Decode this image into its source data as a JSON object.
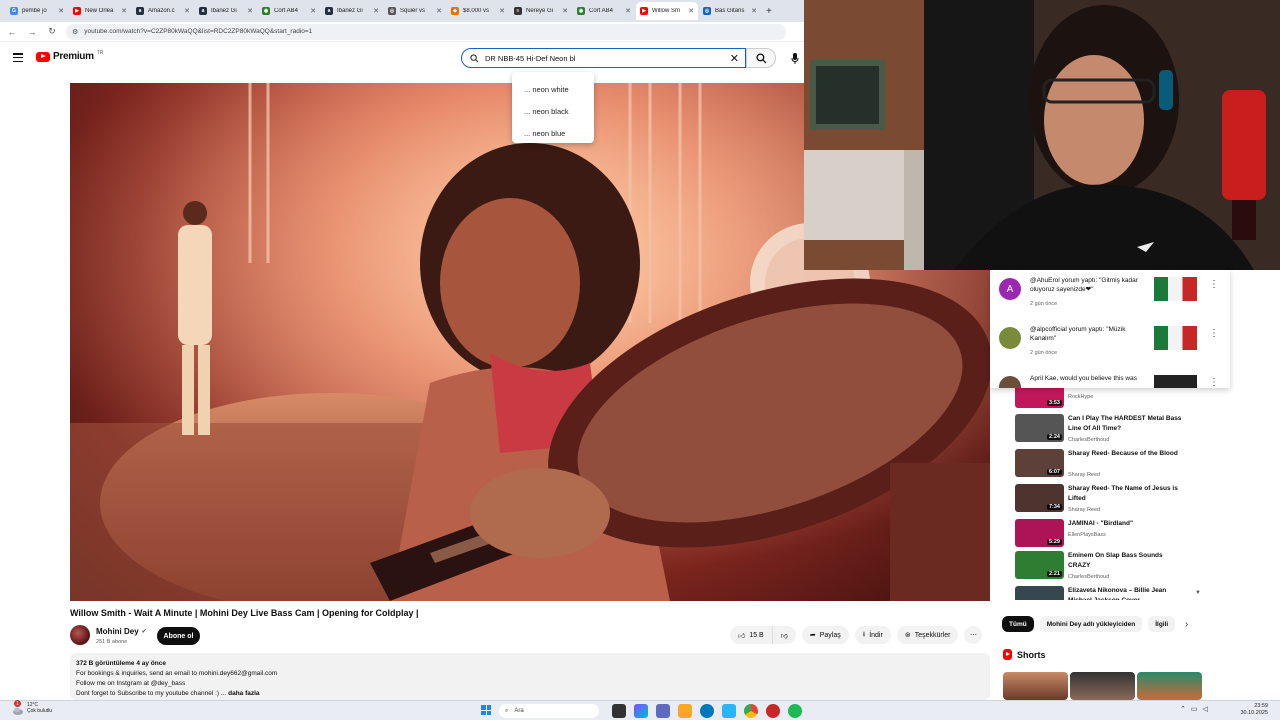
{
  "browser": {
    "tabs": [
      {
        "label": "pembe jo",
        "color": "#4285f4",
        "glyph": "G"
      },
      {
        "label": "New Orlea",
        "color": "#ff0000",
        "glyph": "▶"
      },
      {
        "label": "Amazon.c",
        "color": "#232f3e",
        "glyph": "a"
      },
      {
        "label": "Ibanez Gi",
        "color": "#232f3e",
        "glyph": "a"
      },
      {
        "label": "Cort AB4",
        "color": "#2e7d32",
        "glyph": "◉"
      },
      {
        "label": "Ibanez Gi",
        "color": "#232f3e",
        "glyph": "a"
      },
      {
        "label": "Squier vs",
        "color": "#555555",
        "glyph": "◎"
      },
      {
        "label": "$8.000 vs",
        "color": "#ef6c00",
        "glyph": "◆"
      },
      {
        "label": "Nereye Gi",
        "color": "#333333",
        "glyph": "≡"
      },
      {
        "label": "Cort AB4",
        "color": "#2e7d32",
        "glyph": "◉"
      },
      {
        "label": "Willow Sm",
        "color": "#ff0000",
        "glyph": "▶"
      },
      {
        "label": "Bas Gitaris",
        "color": "#1565c0",
        "glyph": "◎"
      }
    ],
    "active_tab": 10,
    "new_tab": "+",
    "url": "youtube.com/watch?v=C2ZP80kWaQQ&list=RDC2ZP80kWaQQ&start_radio=1"
  },
  "youtube": {
    "logo": "Premium",
    "logo_sup": "TR",
    "search_query": "DR NBB-45 Hi-Def Neon bl",
    "suggestions": [
      "... neon white",
      "... neon black",
      "... neon blue"
    ]
  },
  "video": {
    "title": "Willow Smith - Wait A Minute | Mohini Dey Live Bass Cam | Opening for Coldplay |",
    "channel": "Mohini Dey",
    "subscribers": "251 B abone",
    "subscribe_label": "Abone ol",
    "likes": "15 B",
    "share_label": "Paylaş",
    "download_label": "İndir",
    "thanks_label": "Teşekkürler",
    "views_meta": "372 B görüntüleme  4 ay önce",
    "desc_line1": "For bookings & inquiries, send an email to mohini.dey662@gmail.com",
    "desc_line2": "Follow me on Instgram at @dey_bass",
    "desc_line3": "Dont forget to Subscribe to my youtube channel :) ...",
    "more_label": "daha fazla"
  },
  "notifications": [
    {
      "avatar_letter": "A",
      "avatar_color": "#9c27b0",
      "text": "@AhuErol yorum yaptı: \"Gitmiş kadar oluyoruz sayenizde❤\"",
      "time": "2 gün önce"
    },
    {
      "avatar_letter": "",
      "avatar_color": "#7a8a3a",
      "text": "@alpcofficial yorum yaptı: \"Müzik Kanalım\"",
      "time": "2 gün önce"
    },
    {
      "avatar_letter": "",
      "avatar_color": "#6b4f3a",
      "text": "April Kae, would you believe this was",
      "time": ""
    }
  ],
  "recommended": [
    {
      "title": "",
      "channel": "RockHype",
      "duration": "3:53",
      "color": "#c2185b"
    },
    {
      "title": "Can I Play The HARDEST Metal Bass Line Of All Time?",
      "channel": "CharlesBerthoud",
      "duration": "2:24",
      "color": "#555555"
    },
    {
      "title": "Sharay Reed- Because of the Blood",
      "channel": "Sharay Reed",
      "duration": "6:07",
      "color": "#5d4037"
    },
    {
      "title": "Sharay Reed- The Name of Jesus is Lifted",
      "channel": "Sharay Reed",
      "duration": "7:34",
      "color": "#4e342e"
    },
    {
      "title": "JAMINAI - \"Birdland\"",
      "channel": "EllenPlaysBass",
      "duration": "5:29",
      "color": "#ad1457"
    },
    {
      "title": "Eminem On Slap Bass Sounds CRAZY",
      "channel": "CharlesBerthoud",
      "duration": "2:21",
      "color": "#2e7d32"
    },
    {
      "title": "Elizaveta Nikonova – Billie Jean Michael Jackson Cover",
      "channel": "",
      "duration": "",
      "color": "#37474f"
    }
  ],
  "chips": [
    "Tümü",
    "Mohini Dey adlı yükleyiciden",
    "İlgili"
  ],
  "shorts_label": "Shorts",
  "taskbar": {
    "temp": "12°C",
    "weather": "Çok bulutlu",
    "search_placeholder": "Ara",
    "time": "23:59",
    "date": "30.10.2025",
    "notif_count": "1"
  }
}
